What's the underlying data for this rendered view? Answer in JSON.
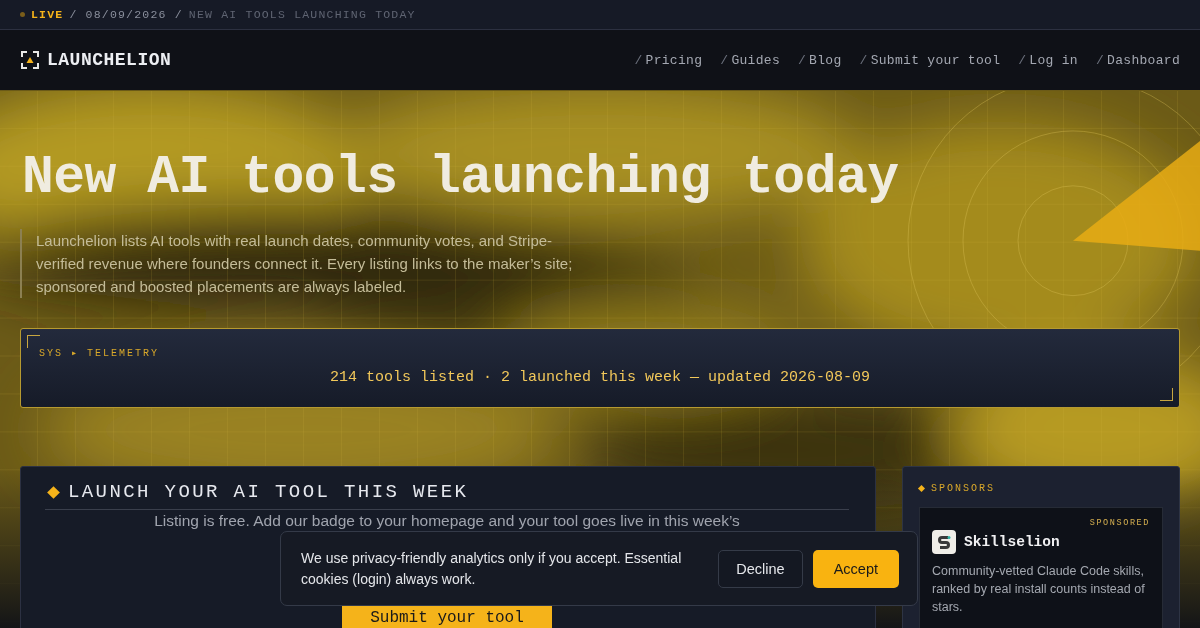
{
  "ticker": {
    "status": "LIVE",
    "date": "/ 08/09/2026 /",
    "headline": "NEW AI TOOLS LAUNCHING TODAY"
  },
  "brand": "LAUNCHELION",
  "nav": [
    {
      "slash": "/",
      "label": "Pricing"
    },
    {
      "slash": "/",
      "label": "Guides"
    },
    {
      "slash": "/",
      "label": "Blog"
    },
    {
      "slash": "/",
      "label": "Submit your tool"
    },
    {
      "slash": "/",
      "label": "Log in"
    },
    {
      "slash": "/",
      "label": "Dashboard"
    }
  ],
  "hero": {
    "title": "New AI tools launching today",
    "intro": "Launchelion lists AI tools with real launch dates, community votes, and Stripe-verified revenue where founders connect it. Every listing links to the maker’s site; sponsored and boosted placements are always labeled."
  },
  "telemetry": {
    "label": "SYS ▸ TELEMETRY",
    "stats": "214 tools listed · 2 launched this week — updated 2026-08-09"
  },
  "launch_card": {
    "title": "LAUNCH YOUR AI TOOL THIS WEEK",
    "text": "Listing is free. Add our badge to your homepage and your tool goes live in this week’s",
    "button": "Submit your tool"
  },
  "sponsors": {
    "title": "SPONSORS",
    "items": [
      {
        "badge": "SPONSORED",
        "name": "Skillselion",
        "description": "Community-vetted Claude Code skills, ranked by real install counts instead of stars."
      }
    ]
  },
  "cookie_banner": {
    "text": "We use privacy-friendly analytics only if you accept. Essential cookies (login) always work.",
    "buttons": [
      {
        "label": "Decline",
        "kind": "secondary"
      },
      {
        "label": "Accept",
        "kind": "primary"
      }
    ]
  }
}
